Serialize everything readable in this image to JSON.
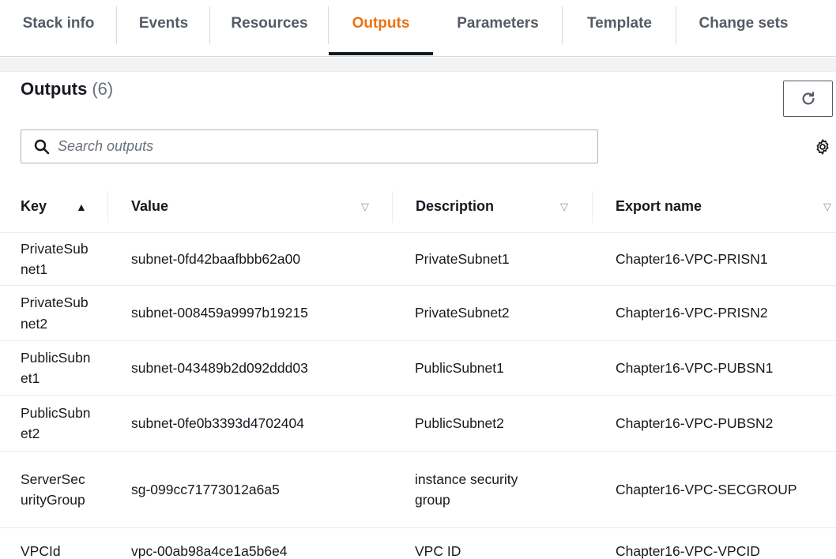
{
  "tabs": [
    {
      "label": "Stack info",
      "active": false
    },
    {
      "label": "Events",
      "active": false
    },
    {
      "label": "Resources",
      "active": false
    },
    {
      "label": "Outputs",
      "active": true
    },
    {
      "label": "Parameters",
      "active": false
    },
    {
      "label": "Template",
      "active": false
    },
    {
      "label": "Change sets",
      "active": false
    }
  ],
  "header": {
    "title": "Outputs",
    "count": "(6)"
  },
  "search": {
    "placeholder": "Search outputs",
    "value": ""
  },
  "table": {
    "columns": [
      {
        "label": "Key",
        "sort": "ascending"
      },
      {
        "label": "Value",
        "sort": "none"
      },
      {
        "label": "Description",
        "sort": "none"
      },
      {
        "label": "Export name",
        "sort": "none"
      }
    ],
    "rows": [
      {
        "key": "PrivateSubnet1",
        "value": "subnet-0fd42baafbbb62a00",
        "description": "PrivateSubnet1",
        "export": "Chapter16-VPC-PRISN1"
      },
      {
        "key": "PrivateSubnet2",
        "value": "subnet-008459a9997b19215",
        "description": "PrivateSubnet2",
        "export": "Chapter16-VPC-PRISN2"
      },
      {
        "key": "PublicSubnet1",
        "value": "subnet-043489b2d092ddd03",
        "description": "PublicSubnet1",
        "export": "Chapter16-VPC-PUBSN1"
      },
      {
        "key": "PublicSubnet2",
        "value": "subnet-0fe0b3393d4702404",
        "description": "PublicSubnet2",
        "export": "Chapter16-VPC-PUBSN2"
      },
      {
        "key": "ServerSecurityGroup",
        "value": "sg-099cc71773012a6a5",
        "description": "instance security group",
        "export": "Chapter16-VPC-SECGROUP"
      },
      {
        "key": "VPCId",
        "value": "vpc-00ab98a4ce1a5b6e4",
        "description": "VPC ID",
        "export": "Chapter16-VPC-VPCID"
      }
    ]
  },
  "colors": {
    "accent": "#ec7211",
    "text": "#16191f",
    "muted": "#687078"
  },
  "icons": {
    "search": "search-icon",
    "refresh": "refresh-icon",
    "settings": "gear-icon"
  }
}
